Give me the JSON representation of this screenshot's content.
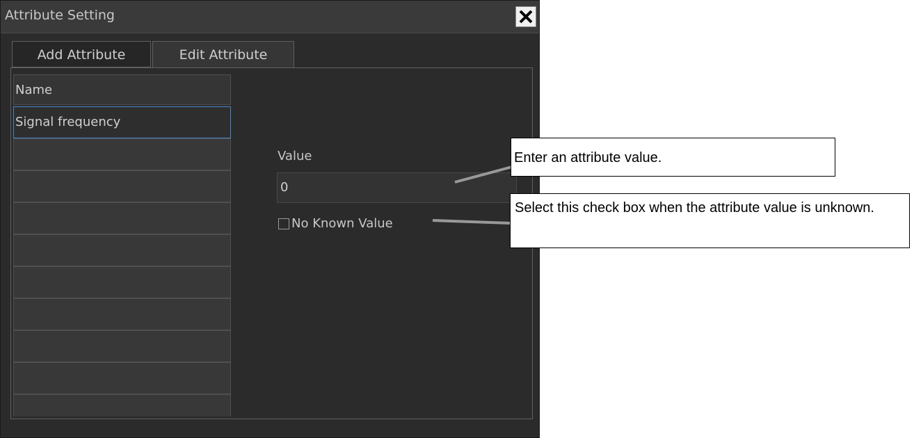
{
  "dialog": {
    "title": "Attribute Setting",
    "close_icon": "close-icon"
  },
  "tabs": [
    {
      "label": "Add Attribute",
      "active": false
    },
    {
      "label": "Edit Attribute",
      "active": true
    }
  ],
  "list": {
    "header": "Name",
    "rows": [
      "Signal frequency",
      "",
      "",
      "",
      "",
      "",
      "",
      "",
      "",
      ""
    ],
    "selected_index": 0
  },
  "value_field": {
    "label": "Value",
    "value": "0"
  },
  "no_known_value": {
    "label": "No Known Value",
    "checked": false
  },
  "callouts": [
    "Enter an attribute value.",
    "Select this check box when the attribute value is unknown."
  ],
  "colors": {
    "dialog_bg": "#2b2b2b",
    "selection_border": "#4a86c8",
    "text": "#d0d0d0"
  }
}
